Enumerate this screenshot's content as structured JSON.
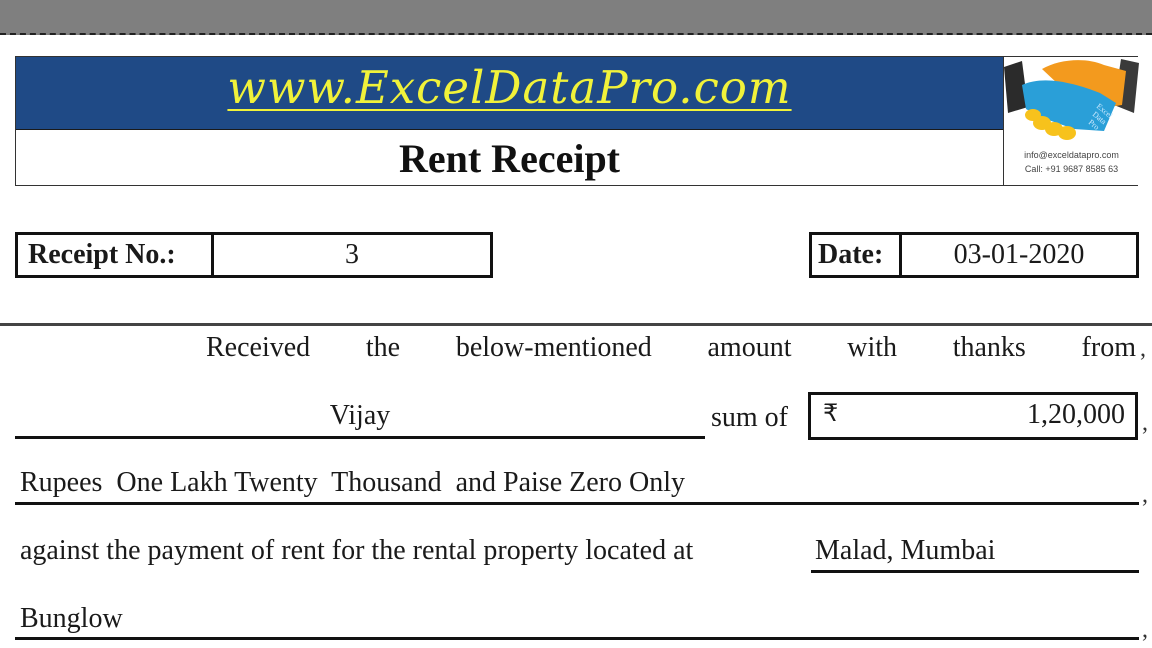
{
  "header": {
    "website": "www.ExcelDataPro.com",
    "title": "Rent Receipt",
    "logo": {
      "icon": "handshake-icon",
      "brand_text": [
        "Excel",
        "Data",
        "Pro"
      ],
      "email": "info@exceldatapro.com",
      "phone": "Call: +91 9687 8585 63",
      "colors": {
        "blue_hand": "#2a9fd8",
        "orange_hand": "#f39a1e",
        "yellow_fingers": "#f7c21c"
      }
    },
    "banner_color": "#1f4a86",
    "link_color": "#f1f23a"
  },
  "fields": {
    "receipt_no_label": "Receipt No.:",
    "receipt_no_value": "3",
    "date_label": "Date:",
    "date_value": "03-01-2020"
  },
  "body": {
    "line1_words": [
      "Received",
      "the",
      "below-mentioned",
      "amount",
      "with",
      "thanks",
      "from"
    ],
    "payer_name": "Vijay",
    "sum_of_label": "sum of",
    "currency_symbol": "₹",
    "amount": "1,20,000",
    "amount_in_words": "Rupees  One Lakh Twenty  Thousand  and Paise Zero Only",
    "against_text": "against the payment of rent for the rental property located at",
    "location": "Malad, Mumbai",
    "property_type": "Bunglow",
    "comma": ","
  }
}
